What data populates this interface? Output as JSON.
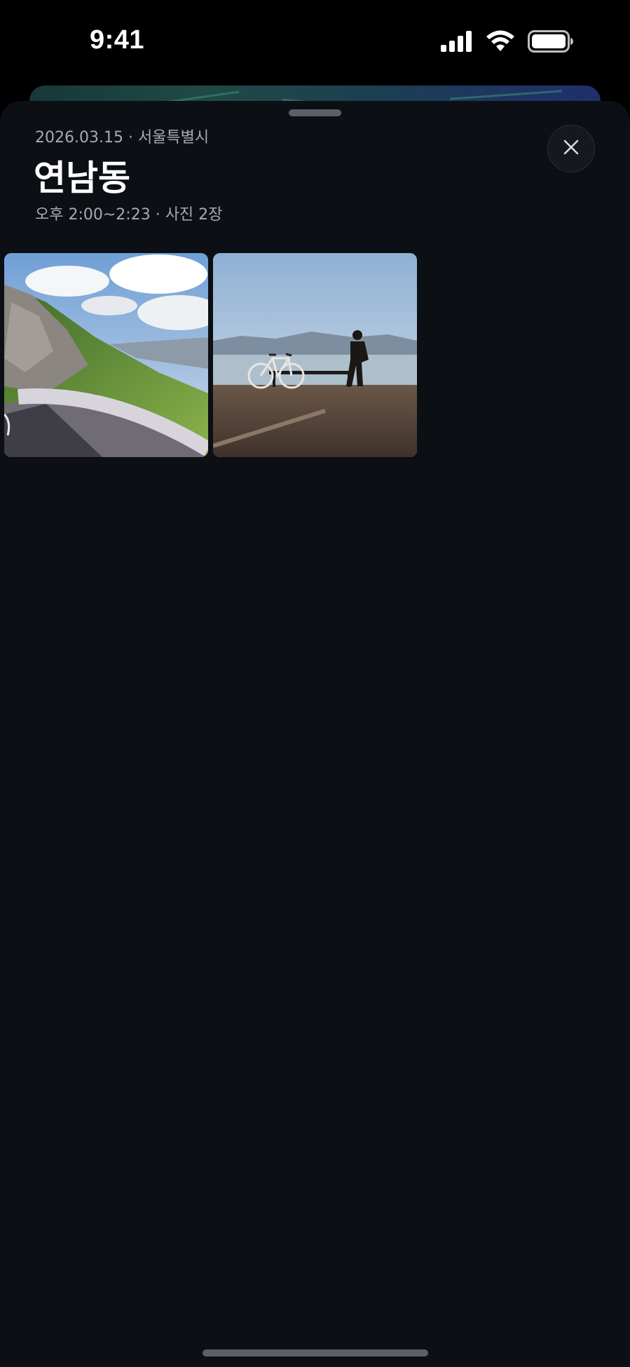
{
  "status_bar": {
    "time": "9:41",
    "icons": [
      "cellular-signal-icon",
      "wifi-icon",
      "battery-icon"
    ]
  },
  "sheet": {
    "meta": "2026.03.15 · 서울특별시",
    "title": "연남동",
    "subtitle": "오후 2:00~2:23 · 사진 2장",
    "close_icon": "close-icon"
  },
  "photos": [
    {
      "subject": "mountain-road"
    },
    {
      "subject": "lakeside-bench-bicycle"
    }
  ],
  "colors": {
    "sheet_background": "#0c0f13",
    "secondary_text": "#a6abb3",
    "primary_text": "#ffffff"
  }
}
